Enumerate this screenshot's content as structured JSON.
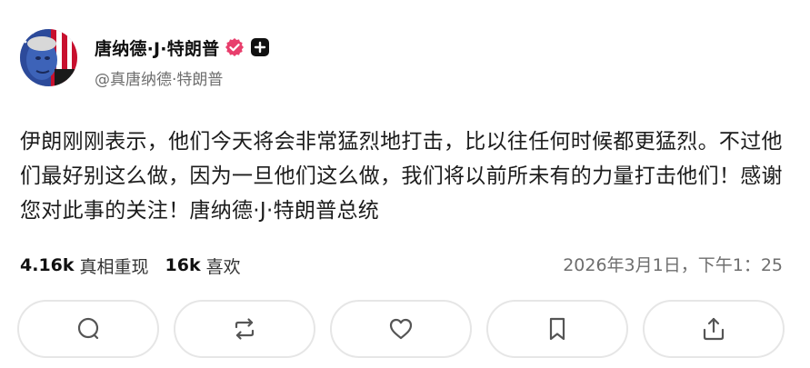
{
  "post": {
    "author": {
      "display_name": "唐纳德·J·特朗普",
      "handle": "@真唐纳德·特朗普",
      "avatar_icon": "avatar-flag-portrait",
      "verified_icon": "verified-badge-icon",
      "verified_color": "#e83e6c",
      "follow_icon": "plus-icon"
    },
    "text": "伊朗刚刚表示，他们今天将会非常猛烈地打击，比以往任何时候都更猛烈。不过他们最好别这么做，因为一旦他们这么做，我们将以前所未有的力量打击他们！感谢您对此事的关注！唐纳德·J·特朗普总统",
    "stats": {
      "retruths_count": "4.16k",
      "retruths_label": "真相重现",
      "likes_count": "16k",
      "likes_label": "喜欢"
    },
    "timestamp": "2026年3月1日，下午1：25",
    "actions": [
      {
        "name": "reply",
        "icon": "comment-icon"
      },
      {
        "name": "retruth",
        "icon": "repost-icon"
      },
      {
        "name": "like",
        "icon": "heart-icon"
      },
      {
        "name": "bookmark",
        "icon": "bookmark-icon"
      },
      {
        "name": "share",
        "icon": "share-icon"
      }
    ]
  }
}
